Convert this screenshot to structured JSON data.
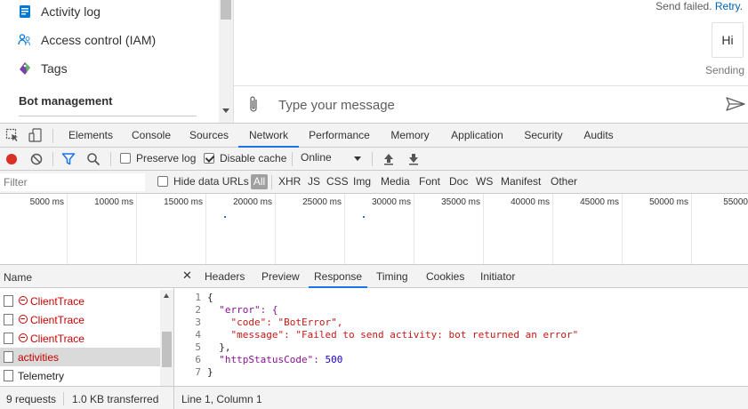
{
  "sidebar": {
    "items": [
      {
        "label": "Activity log",
        "icon": "activity-log-icon"
      },
      {
        "label": "Access control (IAM)",
        "icon": "people-icon"
      },
      {
        "label": "Tags",
        "icon": "tag-icon"
      }
    ],
    "section_title": "Bot management"
  },
  "chat": {
    "send_failed": "Send failed.",
    "retry": "Retry.",
    "message": "Hi",
    "status": "Sending",
    "input_placeholder": "Type your message"
  },
  "devtools": {
    "tabs": [
      "Elements",
      "Console",
      "Sources",
      "Network",
      "Performance",
      "Memory",
      "Application",
      "Security",
      "Audits"
    ],
    "active_tab": "Network",
    "toolbar": {
      "preserve_log": "Preserve log",
      "preserve_log_checked": false,
      "disable_cache": "Disable cache",
      "disable_cache_checked": true,
      "throttling": "Online"
    },
    "filter": {
      "placeholder": "Filter",
      "hide_data_urls": "Hide data URLs",
      "types": [
        "All",
        "XHR",
        "JS",
        "CSS",
        "Img",
        "Media",
        "Font",
        "Doc",
        "WS",
        "Manifest",
        "Other"
      ],
      "active_type": "All"
    },
    "timeline_ticks": [
      "5000 ms",
      "10000 ms",
      "15000 ms",
      "20000 ms",
      "25000 ms",
      "30000 ms",
      "35000 ms",
      "40000 ms",
      "45000 ms",
      "50000 ms",
      "55000"
    ],
    "requests": {
      "header": "Name",
      "rows": [
        {
          "name": "ClientTrace",
          "error": true
        },
        {
          "name": "ClientTrace",
          "error": true
        },
        {
          "name": "ClientTrace",
          "error": true
        },
        {
          "name": "activities",
          "error": true,
          "selected": true
        },
        {
          "name": "Telemetry",
          "error": false
        }
      ]
    },
    "detail_tabs": [
      "Headers",
      "Preview",
      "Response",
      "Timing",
      "Cookies",
      "Initiator"
    ],
    "active_detail_tab": "Response",
    "response_lines": [
      {
        "n": "1",
        "t": "{"
      },
      {
        "n": "2",
        "t": "  \"error\": {"
      },
      {
        "n": "3",
        "t": "    \"code\": \"BotError\","
      },
      {
        "n": "4",
        "t": "    \"message\": \"Failed to send activity: bot returned an error\""
      },
      {
        "n": "5",
        "t": "  },"
      },
      {
        "n": "6",
        "t": "  \"httpStatusCode\": 500"
      },
      {
        "n": "7",
        "t": "}"
      }
    ],
    "status": {
      "requests": "9 requests",
      "transferred": "1.0 KB transferred",
      "cursor": "Line 1, Column 1"
    }
  }
}
